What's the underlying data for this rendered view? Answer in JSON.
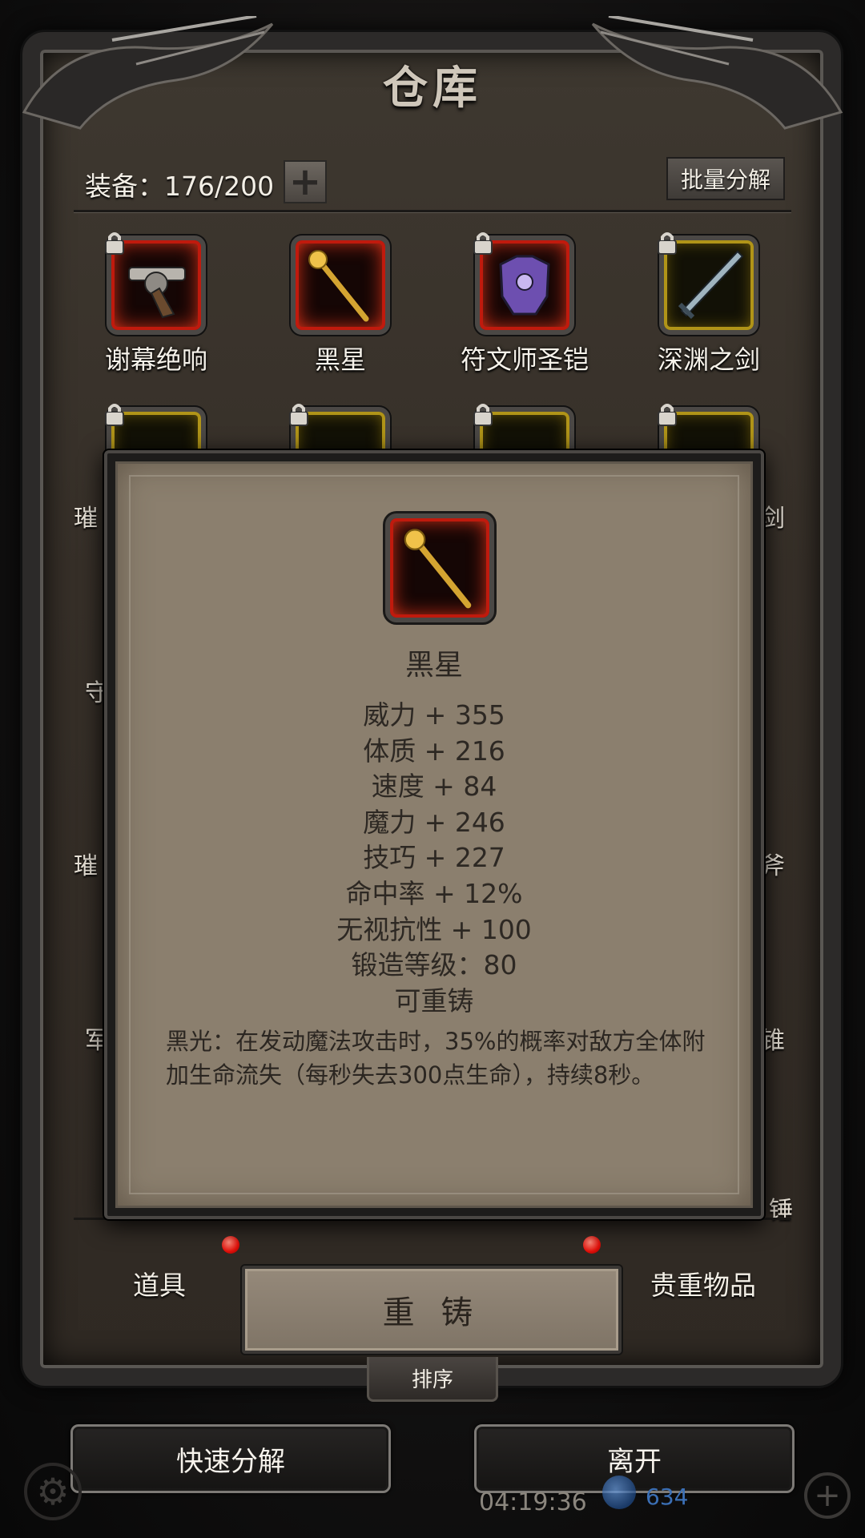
{
  "window": {
    "title": "仓库"
  },
  "header": {
    "equip_count": "装备：176/200",
    "batch_label": "批量分解"
  },
  "items": [
    {
      "label": "谢幕绝响",
      "icon": "revolver-icon",
      "rarity": "red"
    },
    {
      "label": "黑星",
      "icon": "golden-scepter-icon",
      "rarity": "red"
    },
    {
      "label": "符文师圣铠",
      "icon": "purple-armor-icon",
      "rarity": "red"
    },
    {
      "label": "深渊之剑",
      "icon": "dark-sword-icon",
      "rarity": "gold"
    }
  ],
  "partial_labels": {
    "row2_left": "璀",
    "row2_right": "剑",
    "row3_left": "守",
    "row4_left": "璀",
    "row4_right": "斧",
    "row5_left": "军",
    "row5_right": "锥",
    "row6_right": "锤"
  },
  "tabs": {
    "left": "道具",
    "right": "贵重物品"
  },
  "sort_label": "排序",
  "buttons": {
    "quick_decompose": "快速分解",
    "leave": "离开",
    "reforge": "重 铸"
  },
  "status": {
    "clock": "04:19:36",
    "crystal": "634"
  },
  "tooltip": {
    "name": "黑星",
    "stats": [
      "威力 + 355",
      "体质 + 216",
      "速度 + 84",
      "魔力 + 246",
      "技巧 + 227",
      "命中率 + 12%",
      "无视抗性 + 100",
      "锻造等级：80",
      "可重铸"
    ],
    "description": "黑光：在发动魔法攻击时，35%的概率对敌方全体附加生命流失（每秒失去300点生命），持续8秒。"
  },
  "colors": {
    "rarity_red": "#c01a0d",
    "rarity_gold": "#b09418",
    "notice_dot": "#e0100a"
  }
}
